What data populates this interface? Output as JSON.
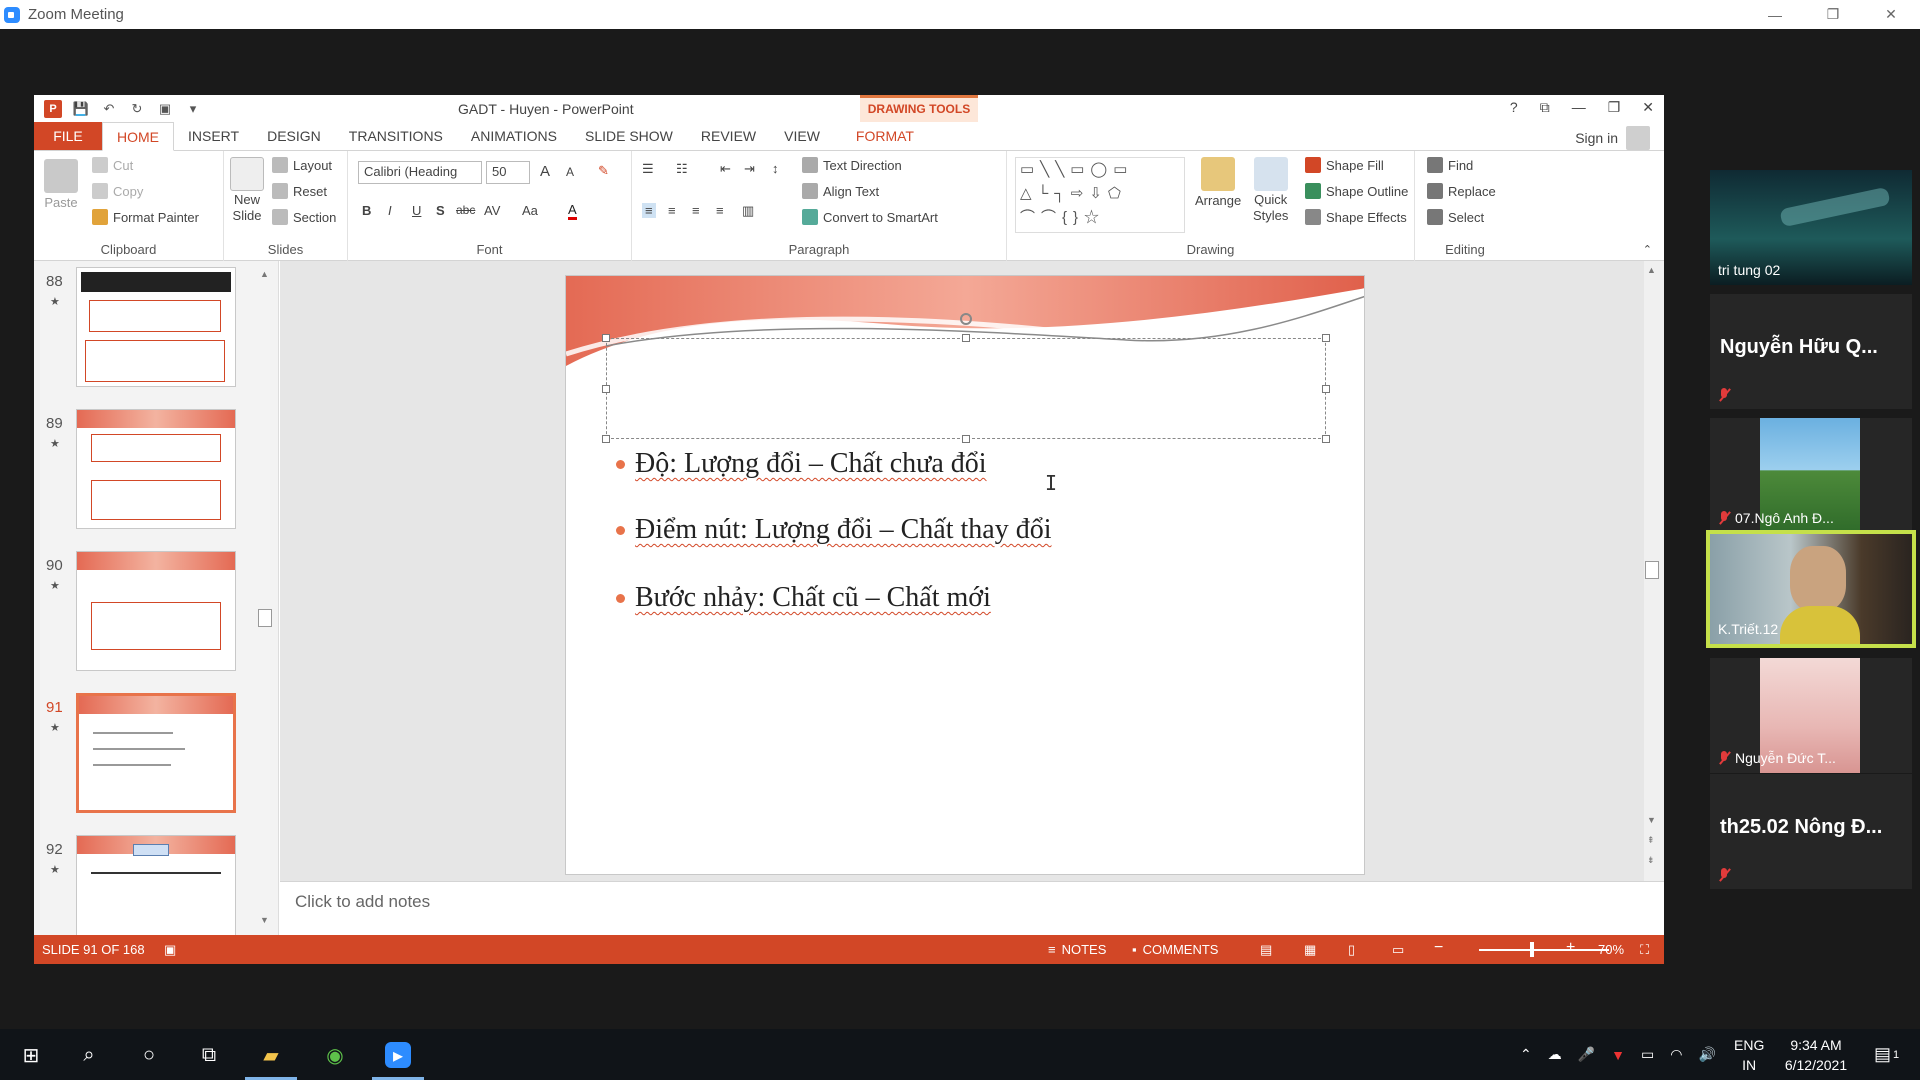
{
  "zoom": {
    "title": "Zoom Meeting",
    "min": "—",
    "restore": "❐",
    "close": "✕"
  },
  "ppt": {
    "title": "GADT - Huyen - PowerPoint",
    "drawing_tools": "DRAWING TOOLS",
    "help": "?",
    "ribbon_display": "⧉",
    "min": "—",
    "restore": "❐",
    "close": "✕",
    "tabs": [
      "FILE",
      "HOME",
      "INSERT",
      "DESIGN",
      "TRANSITIONS",
      "ANIMATIONS",
      "SLIDE SHOW",
      "REVIEW",
      "VIEW",
      "FORMAT"
    ],
    "signin": "Sign in",
    "ribbon": {
      "clipboard": {
        "label": "Clipboard",
        "paste": "Paste",
        "cut": "Cut",
        "copy": "Copy",
        "format_painter": "Format Painter"
      },
      "slides": {
        "label": "Slides",
        "new_slide": "New",
        "new_slide2": "Slide",
        "layout": "Layout",
        "reset": "Reset",
        "section": "Section"
      },
      "font": {
        "label": "Font",
        "font_name": "Calibri (Heading",
        "font_size": "50",
        "grow": "A",
        "shrink": "A",
        "bold": "B",
        "italic": "I",
        "underline": "U",
        "shadow": "S",
        "strike": "abc",
        "spacing": "AV",
        "case": "Aa",
        "color": "A"
      },
      "paragraph": {
        "label": "Paragraph",
        "text_direction": "Text Direction",
        "align_text": "Align Text",
        "smartart": "Convert to SmartArt"
      },
      "drawing": {
        "label": "Drawing",
        "arrange": "Arrange",
        "quick": "Quick",
        "styles": "Styles",
        "fill": "Shape Fill",
        "outline": "Shape Outline",
        "effects": "Shape Effects"
      },
      "editing": {
        "label": "Editing",
        "find": "Find",
        "replace": "Replace",
        "select": "Select"
      }
    },
    "thumbs": [
      {
        "num": "88",
        "star": "★"
      },
      {
        "num": "89",
        "star": "★"
      },
      {
        "num": "90",
        "star": "★"
      },
      {
        "num": "91",
        "star": "★"
      },
      {
        "num": "92",
        "star": "★"
      }
    ],
    "slide": {
      "bullets": [
        "Độ: Lượng đổi – Chất chưa đổi",
        "Điểm nút: Lượng đổi – Chất thay đổi",
        "Bước nhảy: Chất cũ – Chất mới"
      ]
    },
    "notes_placeholder": "Click to add notes",
    "status": {
      "slide_info": "SLIDE 91 OF 168",
      "notes": "NOTES",
      "comments": "COMMENTS",
      "zoom_minus": "−",
      "zoom_plus": "+",
      "zoom": "70%"
    }
  },
  "participants": [
    {
      "name": "tri tung 02",
      "muted": false
    },
    {
      "name": "Nguyễn Hữu Q...",
      "muted": true
    },
    {
      "name": "07.Ngô Anh Đ...",
      "muted": true
    },
    {
      "name": "K.Triết.12",
      "muted": false
    },
    {
      "name": "Nguyễn Đức T...",
      "muted": true
    },
    {
      "name": "th25.02 Nông Đ...",
      "muted": true
    }
  ],
  "taskbar": {
    "lang1": "ENG",
    "lang2": "IN",
    "time": "9:34 AM",
    "date": "6/12/2021",
    "notif": "1"
  }
}
